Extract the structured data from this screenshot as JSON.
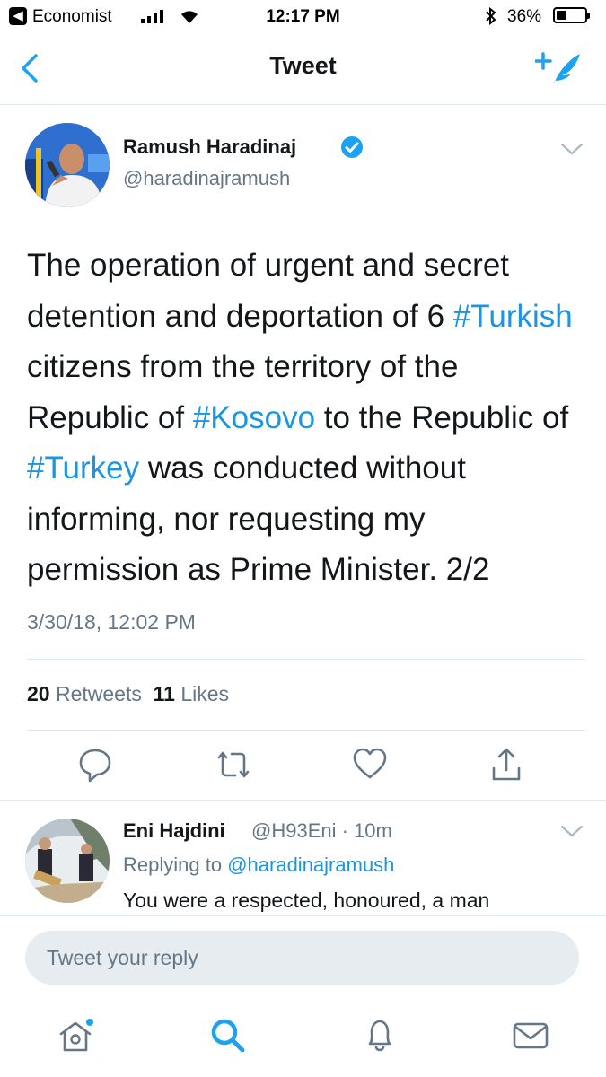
{
  "status_bar": {
    "back_app_label": "Economist",
    "time": "12:17 PM",
    "battery_pct": "36%",
    "battery_level": 0.36
  },
  "nav": {
    "title": "Tweet",
    "back_icon": "chevron-left-icon",
    "compose_icon": "compose-tweet-icon"
  },
  "tweet": {
    "author_name": "Ramush Haradinaj",
    "author_handle": "@haradinajramush",
    "verified": true,
    "text_segments": [
      {
        "t": "The operation of urgent and secret detention and deportation of 6 ",
        "tag": false
      },
      {
        "t": "#Turkish",
        "tag": true
      },
      {
        "t": " citizens from the territory of the Republic of ",
        "tag": false
      },
      {
        "t": "#Kosovo",
        "tag": true
      },
      {
        "t": " to the Republic of ",
        "tag": false
      },
      {
        "t": "#Turkey",
        "tag": true
      },
      {
        "t": " was conducted without informing, nor requesting my permission as Prime Minister. 2/2",
        "tag": false
      }
    ],
    "timestamp": "3/30/18, 12:02 PM",
    "retweets_count": "20",
    "retweets_label": "Retweets",
    "likes_count": "11",
    "likes_label": "Likes"
  },
  "reply": {
    "name": "Eni Hajdini",
    "handle_time": "@H93Eni · 10m",
    "replying_prefix": "Replying to",
    "replying_handle": "@haradinajramush",
    "text": "You were a respected, honoured, a man"
  },
  "composer": {
    "placeholder": "Tweet your reply"
  },
  "colors": {
    "accent": "#1da1f2",
    "hashtag": "#1b95e0",
    "muted": "#657786"
  }
}
